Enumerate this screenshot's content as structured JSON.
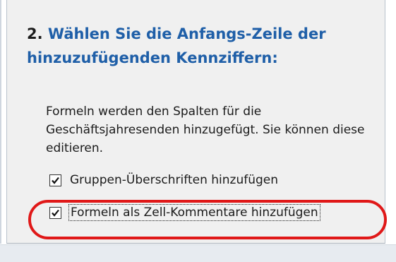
{
  "step": {
    "number": "2.",
    "title": "Wählen Sie die Anfangs-Zeile der hinzuzufügenden Kennziffern:"
  },
  "description": "Formeln werden den Spalten für die Geschäftsjahresenden hinzugefügt. Sie können diese editieren.",
  "options": [
    {
      "label": "Gruppen-Überschriften hinzufügen",
      "checked": true
    },
    {
      "label": "Formeln als Zell-Kommentare hinzufügen",
      "checked": true,
      "focused": true,
      "highlighted": true
    }
  ],
  "colors": {
    "heading": "#1f5fa8",
    "panel_background": "#f0f0f0",
    "highlight_ring": "#e01818"
  }
}
